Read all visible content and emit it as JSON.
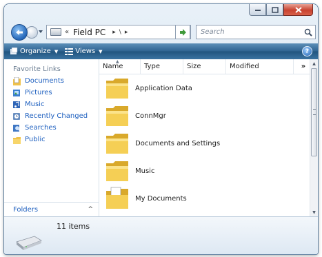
{
  "window": {
    "caption_buttons": [
      "minimize-icon",
      "maximize-icon",
      "close-icon"
    ]
  },
  "address_bar": {
    "overflow": "«",
    "crumb": "Field PC",
    "separator_1": "▸",
    "separator_2": "\\",
    "separator_3": "▸",
    "dropdown": "▾"
  },
  "search": {
    "placeholder": "Search"
  },
  "command_bar": {
    "organize_label": "Organize",
    "views_label": "Views",
    "help_label": "?"
  },
  "nav_pane": {
    "heading": "Favorite Links",
    "items": [
      {
        "label": "Documents",
        "icon": "documents-icon"
      },
      {
        "label": "Pictures",
        "icon": "pictures-icon"
      },
      {
        "label": "Music",
        "icon": "music-icon"
      },
      {
        "label": "Recently Changed",
        "icon": "recently-changed-icon"
      },
      {
        "label": "Searches",
        "icon": "searches-icon"
      },
      {
        "label": "Public",
        "icon": "public-folder-icon"
      }
    ],
    "folders_label": "Folders",
    "folders_chevron": "^"
  },
  "file_list": {
    "columns": [
      "Name",
      "Type",
      "Size",
      "Modified"
    ],
    "more_columns": "»",
    "items": [
      {
        "name": "Application Data",
        "icon": "folder-icon"
      },
      {
        "name": "ConnMgr",
        "icon": "folder-icon"
      },
      {
        "name": "Documents and Settings",
        "icon": "folder-icon"
      },
      {
        "name": "Music",
        "icon": "folder-icon"
      },
      {
        "name": "My Documents",
        "icon": "documents-folder-icon"
      }
    ]
  },
  "details_pane": {
    "item_count": "11 items",
    "icon": "drive-icon"
  },
  "colors": {
    "command_bar": "#2e6391",
    "link": "#1d5fbf",
    "folder": "#f2c84b"
  }
}
